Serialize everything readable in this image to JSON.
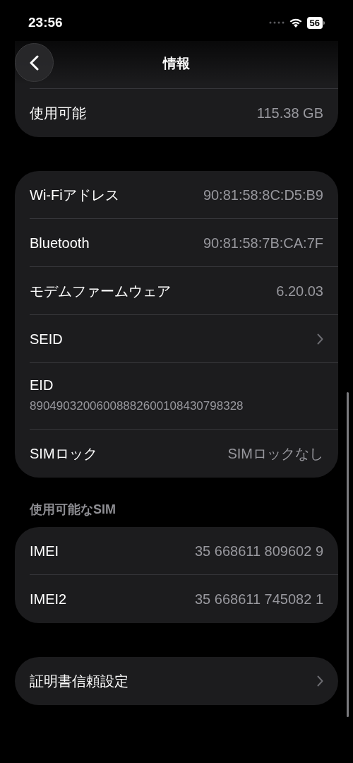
{
  "status_bar": {
    "time": "23:56",
    "battery": "56"
  },
  "nav": {
    "title": "情報"
  },
  "sections": [
    {
      "rows": [
        {
          "kind": "value",
          "label": "使用可能",
          "value": "115.38 GB"
        }
      ]
    },
    {
      "rows": [
        {
          "kind": "value",
          "label": "Wi-Fiアドレス",
          "value": "90:81:58:8C:D5:B9"
        },
        {
          "kind": "value",
          "label": "Bluetooth",
          "value": "90:81:58:7B:CA:7F"
        },
        {
          "kind": "value",
          "label": "モデムファームウェア",
          "value": "6.20.03"
        },
        {
          "kind": "link",
          "label": "SEID"
        },
        {
          "kind": "stacked",
          "label": "EID",
          "value": "89049032006008882600108430798328"
        },
        {
          "kind": "value",
          "label": "SIMロック",
          "value": "SIMロックなし"
        }
      ]
    },
    {
      "header": "使用可能なSIM",
      "rows": [
        {
          "kind": "value",
          "label": "IMEI",
          "value": "35 668611 809602 9"
        },
        {
          "kind": "value",
          "label": "IMEI2",
          "value": "35 668611 745082 1"
        }
      ]
    },
    {
      "rows": [
        {
          "kind": "link",
          "label": "証明書信頼設定"
        }
      ]
    }
  ]
}
